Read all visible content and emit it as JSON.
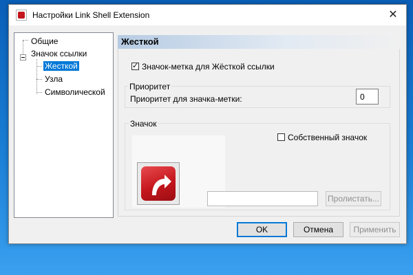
{
  "window": {
    "title": "Настройки Link Shell Extension",
    "close_glyph": "✕"
  },
  "tree": {
    "items": [
      {
        "label": "Общие"
      },
      {
        "label": "Значок ссылки"
      },
      {
        "label": "Жесткой"
      },
      {
        "label": "Узла"
      },
      {
        "label": "Символической"
      }
    ]
  },
  "page": {
    "header": "Жесткой",
    "hardlink_icon_checkbox": {
      "label": "Значок-метка для Жёсткой ссылки",
      "checked": true
    },
    "priority_group": {
      "label": "Приоритет",
      "field_label": "Приоритет для значка-метки:",
      "value": "0"
    },
    "icon_group": {
      "label": "Значок",
      "own_icon_checkbox": {
        "label": "Собственный значок",
        "checked": false
      },
      "path_value": "",
      "browse_label": "Пролистать..."
    }
  },
  "footer": {
    "ok_label": "OK",
    "cancel_label": "Отмена",
    "apply_label": "Применить"
  },
  "colors": {
    "selection": "#0078d7",
    "accent_red": "#c4161c"
  }
}
